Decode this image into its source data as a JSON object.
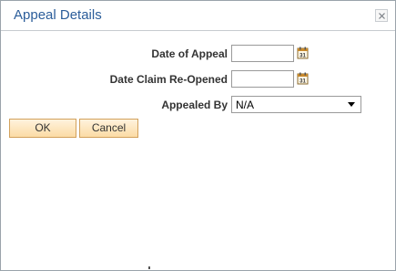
{
  "dialog": {
    "title": "Appeal Details",
    "close_icon": "close-icon"
  },
  "form": {
    "date_of_appeal_label": "Date of Appeal",
    "date_of_appeal_value": "",
    "date_claim_reopened_label": "Date Claim Re-Opened",
    "date_claim_reopened_value": "",
    "appealed_by_label": "Appealed By",
    "appealed_by_value": "N/A",
    "calendar_icon": "calendar-icon"
  },
  "buttons": {
    "ok_label": "OK",
    "cancel_label": "Cancel"
  },
  "colors": {
    "title": "#2b5d9a",
    "button_border": "#d2a15c",
    "button_fill": "#fbdba5"
  }
}
